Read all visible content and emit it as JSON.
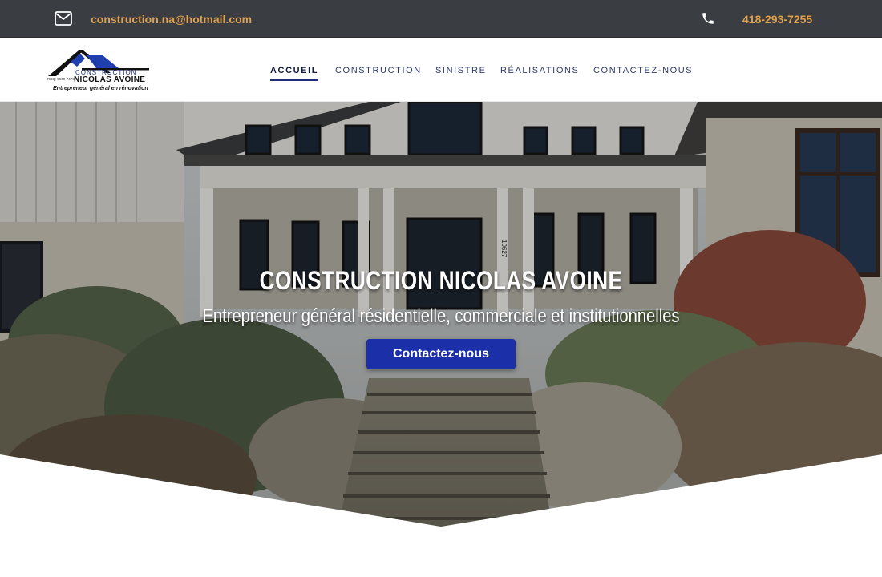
{
  "topbar": {
    "email": "construction.na@hotmail.com",
    "phone": "418-293-7255",
    "accent_color": "#e0a04c",
    "background_color": "#3a3d42"
  },
  "logo": {
    "brand_top": "CONSTRUCTION",
    "brand_name": "NICOLAS AVOINE",
    "rbq": "RBQ: 5660-7479-01",
    "tagline": "Entrepreneur général en rénovation"
  },
  "nav": {
    "items": [
      {
        "label": "ACCUEIL",
        "active": true
      },
      {
        "label": "CONSTRUCTION",
        "active": false
      },
      {
        "label": "SINISTRE",
        "active": false
      },
      {
        "label": "RÉALISATIONS",
        "active": false
      },
      {
        "label": "CONTACTEZ-NOUS",
        "active": false
      }
    ]
  },
  "hero": {
    "title": "CONSTRUCTION NICOLAS AVOINE",
    "subtitle": "Entrepreneur général résidentielle, commerciale et institutionnelles",
    "cta_label": "Contactez-nous",
    "cta_color": "#1a2fa8",
    "house_number": "10627"
  }
}
